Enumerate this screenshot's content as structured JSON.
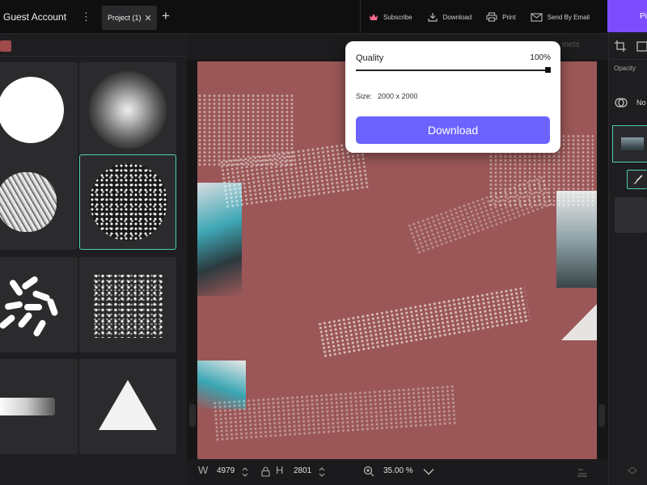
{
  "topbar": {
    "account_label": "Guest Account",
    "more_glyph": "⋮",
    "tab_label": "Project (1)",
    "tab_close_glyph": "✕",
    "new_tab_glyph": "+",
    "actions": [
      {
        "label": "Subscribe",
        "icon": "crown-icon"
      },
      {
        "label": "Download",
        "icon": "download-icon"
      },
      {
        "label": "Print",
        "icon": "printer-icon"
      },
      {
        "label": "Send By Email",
        "icon": "mail-icon"
      }
    ],
    "pill_label": "Pi"
  },
  "layers_hint": "mets",
  "right_panel": {
    "opacity_label": "Opacity",
    "blend_label": "No"
  },
  "popup": {
    "quality_label": "Quality",
    "quality_value": "100%",
    "quality_fraction": 1.0,
    "size_label": "Size:",
    "size_value": "2000 x 2000",
    "download_button": "Download"
  },
  "bottombar": {
    "w_label": "W",
    "w_value": "4979",
    "h_label": "H",
    "h_value": "2801",
    "zoom_value": "35.00 %"
  },
  "colors": {
    "accent": "#6c63ff",
    "brand_purple": "#7c4dff",
    "selection": "#4ecfa9",
    "paint": "#9b5757"
  }
}
